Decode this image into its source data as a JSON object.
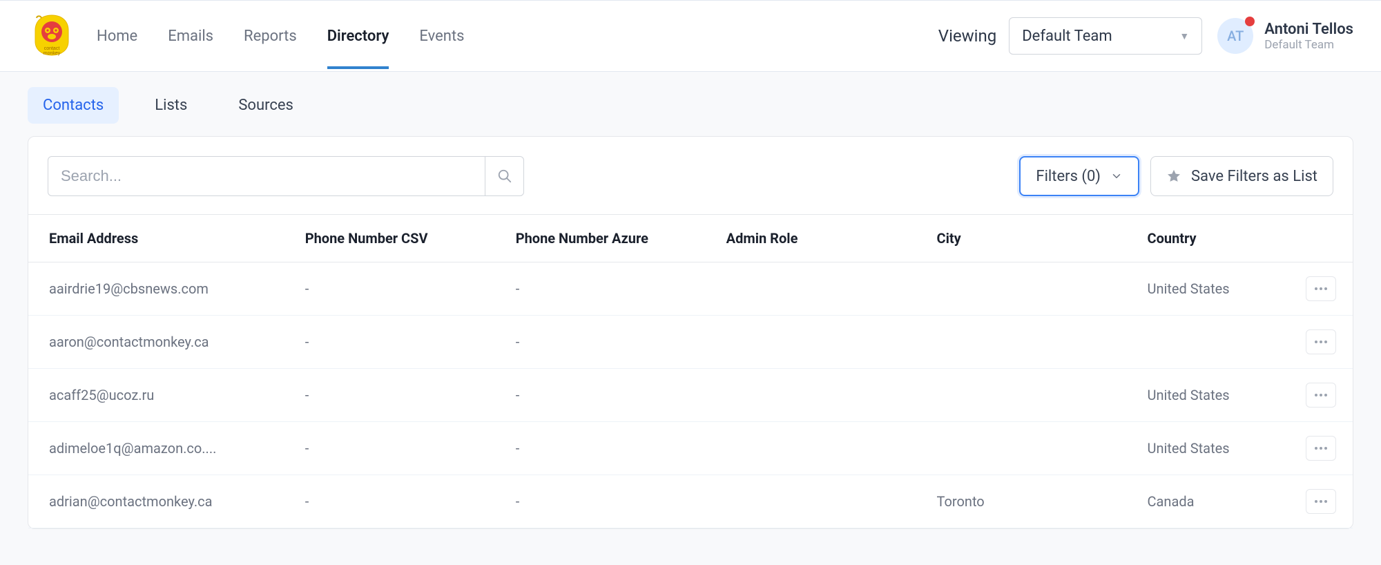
{
  "nav": {
    "items": [
      {
        "label": "Home"
      },
      {
        "label": "Emails"
      },
      {
        "label": "Reports"
      },
      {
        "label": "Directory"
      },
      {
        "label": "Events"
      }
    ],
    "active_index": 3
  },
  "viewing_label": "Viewing",
  "team_select": {
    "value": "Default Team"
  },
  "user": {
    "initials": "AT",
    "name": "Antoni Tellos",
    "team": "Default Team"
  },
  "subtabs": {
    "items": [
      {
        "label": "Contacts"
      },
      {
        "label": "Lists"
      },
      {
        "label": "Sources"
      }
    ],
    "active_index": 0
  },
  "search": {
    "placeholder": "Search..."
  },
  "filters_button": "Filters (0)",
  "save_filters_button": "Save Filters as List",
  "columns": [
    "Email Address",
    "Phone Number CSV",
    "Phone Number Azure",
    "Admin Role",
    "City",
    "Country"
  ],
  "rows": [
    {
      "email": "aairdrie19@cbsnews.com",
      "phone_csv": "-",
      "phone_azure": "-",
      "admin_role": "",
      "city": "",
      "country": "United States"
    },
    {
      "email": "aaron@contactmonkey.ca",
      "phone_csv": "-",
      "phone_azure": "-",
      "admin_role": "",
      "city": "",
      "country": ""
    },
    {
      "email": "acaff25@ucoz.ru",
      "phone_csv": "-",
      "phone_azure": "-",
      "admin_role": "",
      "city": "",
      "country": "United States"
    },
    {
      "email": "adimeloe1q@amazon.co....",
      "phone_csv": "-",
      "phone_azure": "-",
      "admin_role": "",
      "city": "",
      "country": "United States"
    },
    {
      "email": "adrian@contactmonkey.ca",
      "phone_csv": "-",
      "phone_azure": "-",
      "admin_role": "",
      "city": "Toronto",
      "country": "Canada"
    }
  ]
}
